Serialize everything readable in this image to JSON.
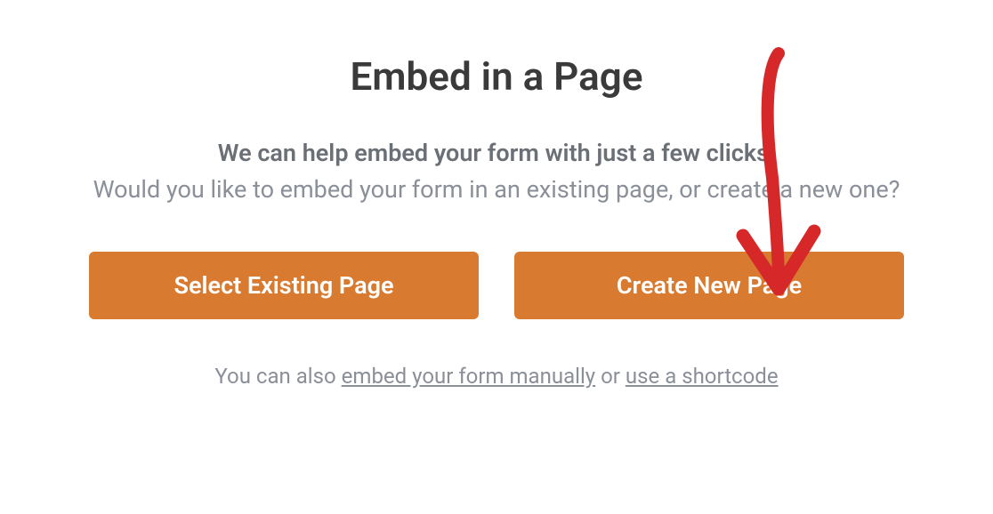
{
  "modal": {
    "title": "Embed in a Page",
    "subtitle_bold": "We can help embed your form with just a few clicks!",
    "subtitle_light": "Would you like to embed your form in an existing page, or create a new one?",
    "buttons": {
      "select_existing": "Select Existing Page",
      "create_new": "Create New Page"
    },
    "footer": {
      "prefix": "You can also ",
      "link_embed": "embed your form manually",
      "middle": " or ",
      "link_shortcode": "use a shortcode"
    }
  },
  "annotation": {
    "type": "arrow",
    "color": "#d62828",
    "target": "create-new-page-button"
  }
}
